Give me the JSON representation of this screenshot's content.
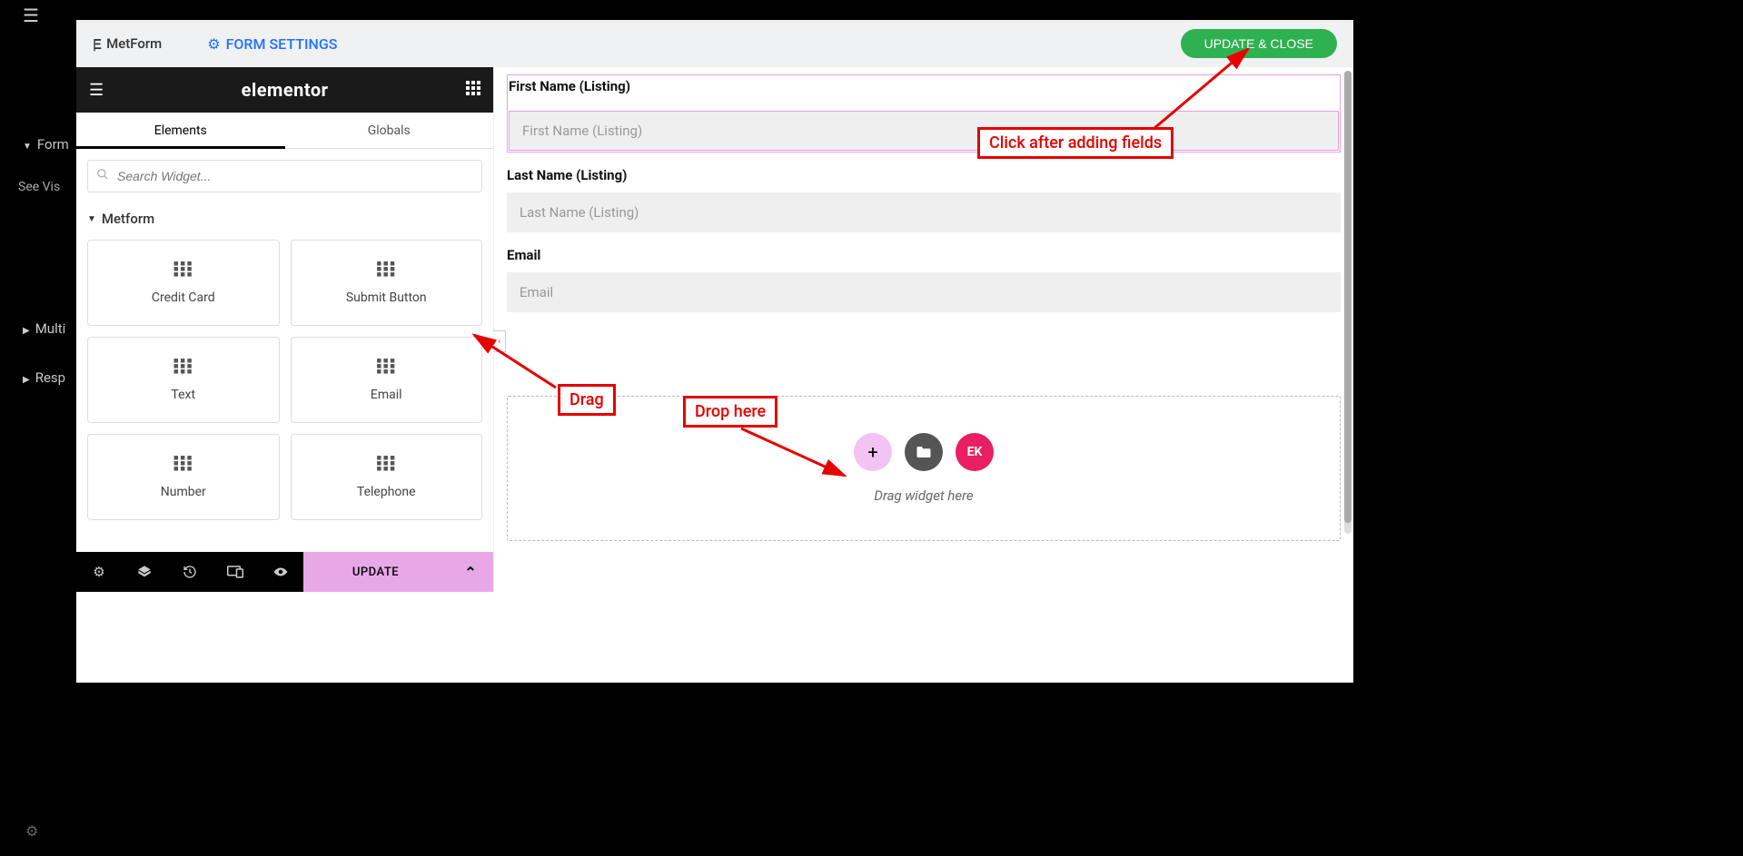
{
  "bg": {
    "form": "Form",
    "see_vis": "See Vis",
    "multi": "Multi",
    "resp": "Resp"
  },
  "header": {
    "metform_label": "MetForm",
    "form_settings_label": "FORM SETTINGS",
    "update_close_label": "UPDATE & CLOSE"
  },
  "panel": {
    "brand": "elementor",
    "tabs": {
      "elements": "Elements",
      "globals": "Globals"
    },
    "search_placeholder": "Search Widget...",
    "category": "Metform",
    "widgets": [
      {
        "label": "Credit Card"
      },
      {
        "label": "Submit Button"
      },
      {
        "label": "Text"
      },
      {
        "label": "Email"
      },
      {
        "label": "Number"
      },
      {
        "label": "Telephone"
      }
    ],
    "footer_update": "UPDATE"
  },
  "canvas": {
    "fields": [
      {
        "label": "First Name (Listing)",
        "placeholder": "First Name (Listing)",
        "highlighted": true
      },
      {
        "label": "Last Name (Listing)",
        "placeholder": "Last Name (Listing)",
        "highlighted": false
      },
      {
        "label": "Email",
        "placeholder": "Email",
        "highlighted": false
      }
    ],
    "dropzone": {
      "ek_label": "EK",
      "text": "Drag widget here"
    }
  },
  "annotations": {
    "click_after": "Click after adding fields",
    "drag": "Drag",
    "drop": "Drop here"
  }
}
